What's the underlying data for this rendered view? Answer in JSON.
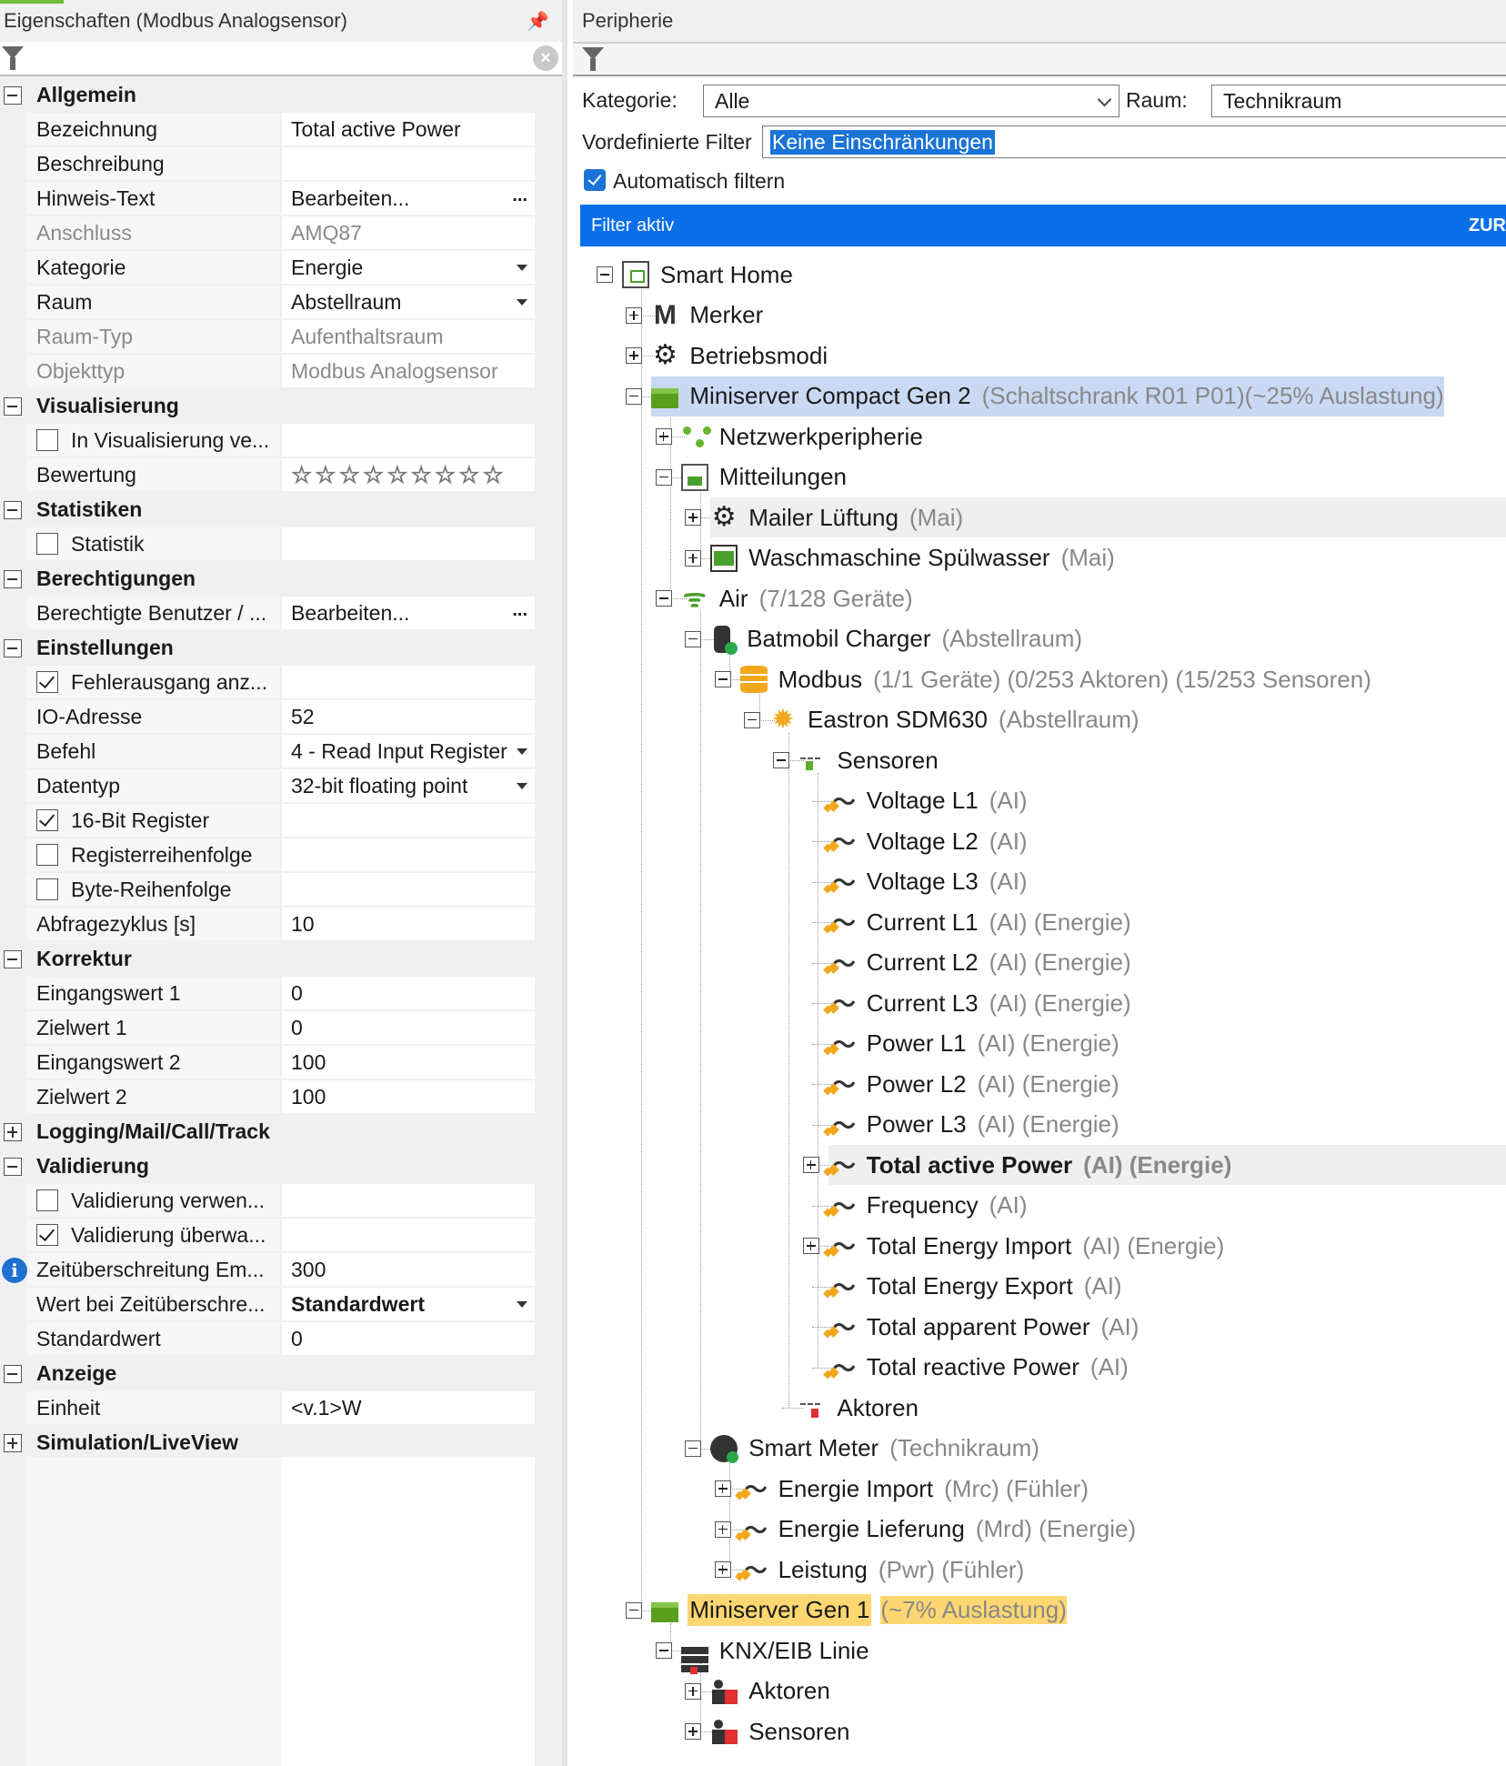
{
  "left_panel": {
    "title": "Eigenschaften (Modbus Analogsensor)",
    "pin_icon": "pin-icon",
    "filter_icon": "funnel-icon",
    "clear_icon": "clear-icon",
    "rows": [
      {
        "type": "cat",
        "expanded": true,
        "name": "Allgemein"
      },
      {
        "type": "prop",
        "name": "Bezeichnung",
        "value": "Total active Power"
      },
      {
        "type": "prop",
        "name": "Beschreibung",
        "value": ""
      },
      {
        "type": "prop",
        "name": "Hinweis-Text",
        "value": "Bearbeiten...",
        "editor": "dots"
      },
      {
        "type": "prop",
        "name": "Anschluss",
        "value": "AMQ87",
        "disabled": true
      },
      {
        "type": "prop",
        "name": "Kategorie",
        "value": "Energie",
        "editor": "dropdown"
      },
      {
        "type": "prop",
        "name": "Raum",
        "value": "Abstellraum",
        "editor": "dropdown"
      },
      {
        "type": "prop",
        "name": "Raum-Typ",
        "value": "Aufenthaltsraum",
        "disabled": true
      },
      {
        "type": "prop",
        "name": "Objekttyp",
        "value": "Modbus Analogsensor",
        "disabled": true
      },
      {
        "type": "cat",
        "expanded": true,
        "name": "Visualisierung"
      },
      {
        "type": "check",
        "name": "In Visualisierung ve...",
        "checked": false
      },
      {
        "type": "prop",
        "name": "Bewertung",
        "value": "☆☆☆☆☆☆☆☆☆",
        "editor": "stars"
      },
      {
        "type": "cat",
        "expanded": true,
        "name": "Statistiken"
      },
      {
        "type": "check",
        "name": "Statistik",
        "checked": false
      },
      {
        "type": "cat",
        "expanded": true,
        "name": "Berechtigungen"
      },
      {
        "type": "prop",
        "name": "Berechtigte Benutzer / ...",
        "value": "Bearbeiten...",
        "editor": "dots"
      },
      {
        "type": "cat",
        "expanded": true,
        "name": "Einstellungen"
      },
      {
        "type": "check",
        "name": "Fehlerausgang anz...",
        "checked": true
      },
      {
        "type": "prop",
        "name": "IO-Adresse",
        "value": "52"
      },
      {
        "type": "prop",
        "name": "Befehl",
        "value": "4 - Read Input Register",
        "editor": "dropdown"
      },
      {
        "type": "prop",
        "name": "Datentyp",
        "value": "32-bit floating point",
        "editor": "dropdown"
      },
      {
        "type": "check",
        "name": "16-Bit Register",
        "checked": true
      },
      {
        "type": "check",
        "name": "Registerreihenfolge",
        "checked": false
      },
      {
        "type": "check",
        "name": "Byte-Reihenfolge",
        "checked": false
      },
      {
        "type": "prop",
        "name": "Abfragezyklus [s]",
        "value": "10"
      },
      {
        "type": "cat",
        "expanded": true,
        "name": "Korrektur"
      },
      {
        "type": "prop",
        "name": "Eingangswert 1",
        "value": "0"
      },
      {
        "type": "prop",
        "name": "Zielwert 1",
        "value": "0"
      },
      {
        "type": "prop",
        "name": "Eingangswert 2",
        "value": "100"
      },
      {
        "type": "prop",
        "name": "Zielwert 2",
        "value": "100"
      },
      {
        "type": "cat",
        "expanded": false,
        "name": "Logging/Mail/Call/Track"
      },
      {
        "type": "cat",
        "expanded": true,
        "name": "Validierung"
      },
      {
        "type": "check",
        "name": "Validierung verwen...",
        "checked": false
      },
      {
        "type": "check",
        "name": "Validierung überwa...",
        "checked": true
      },
      {
        "type": "prop",
        "name": "Zeitüberschreitung Em...",
        "value": "300",
        "info": true
      },
      {
        "type": "prop",
        "name": "Wert bei Zeitüberschre...",
        "value": "Standardwert",
        "editor": "dropdown",
        "bold": true
      },
      {
        "type": "prop",
        "name": "Standardwert",
        "value": "0"
      },
      {
        "type": "cat",
        "expanded": true,
        "name": "Anzeige"
      },
      {
        "type": "prop",
        "name": "Einheit",
        "value": "<v.1>W"
      },
      {
        "type": "cat",
        "expanded": false,
        "name": "Simulation/LiveView"
      }
    ]
  },
  "right_panel": {
    "title": "Peripherie",
    "kategorie_label": "Kategorie:",
    "kategorie_value": "Alle",
    "raum_label": "Raum:",
    "raum_value": "Technikraum",
    "vordefiniert_label": "Vordefinierte Filter",
    "vordefiniert_value": "Keine Einschränkungen",
    "auto_filter_label": "Automatisch filtern",
    "auto_filter_checked": true,
    "filter_active_label": "Filter aktiv",
    "filter_reset_label": "ZUR",
    "accent_color": "#0a6fe8",
    "tree": [
      {
        "depth": 0,
        "exp": "minus",
        "icon": "smart-home-icon",
        "cls": "i-home",
        "label": "Smart Home",
        "sub": ""
      },
      {
        "depth": 1,
        "exp": "plus",
        "icon": "merker-icon",
        "cls": "i-M",
        "glyph": "M",
        "label": "Merker",
        "sub": ""
      },
      {
        "depth": 1,
        "exp": "plus",
        "icon": "gear-icon",
        "cls": "i-gear",
        "glyph": "⚙",
        "label": "Betriebsmodi",
        "sub": ""
      },
      {
        "depth": 1,
        "exp": "minus",
        "icon": "miniserver-icon",
        "cls": "i-server",
        "label": "Miniserver Compact Gen 2",
        "sub": "(Schaltschrank R01 P01)(~25% Auslastung)",
        "hl": "blue"
      },
      {
        "depth": 2,
        "exp": "plus",
        "icon": "network-icon",
        "cls": "i-net",
        "label": "Netzwerkperipherie",
        "sub": ""
      },
      {
        "depth": 2,
        "exp": "minus",
        "icon": "messages-icon",
        "cls": "i-msg",
        "label": "Mitteilungen",
        "sub": ""
      },
      {
        "depth": 3,
        "exp": "plus",
        "icon": "gear-icon",
        "cls": "i-gear",
        "glyph": "⚙",
        "label": "Mailer Lüftung",
        "sub": "(Mai)",
        "hl": "gray"
      },
      {
        "depth": 3,
        "exp": "plus",
        "icon": "mail-icon",
        "cls": "i-mail",
        "label": "Waschmaschine Spülwasser",
        "sub": "(Mai)"
      },
      {
        "depth": 2,
        "exp": "minus",
        "icon": "wifi-icon",
        "cls": "i-wifi",
        "glyph": "ᯤ",
        "label": "Air",
        "sub": "(7/128 Geräte)"
      },
      {
        "depth": 3,
        "exp": "minus",
        "icon": "charger-icon",
        "cls": "i-charger",
        "label": "Batmobil Charger",
        "sub": "(Abstellraum)"
      },
      {
        "depth": 4,
        "exp": "minus",
        "icon": "database-icon",
        "cls": "i-db",
        "label": "Modbus",
        "sub": "(1/1 Geräte) (0/253 Aktoren) (15/253 Sensoren)"
      },
      {
        "depth": 5,
        "exp": "minus",
        "icon": "sun-icon",
        "cls": "i-sun",
        "glyph": "✹",
        "label": "Eastron SDM630",
        "sub": "(Abstellraum)"
      },
      {
        "depth": 6,
        "exp": "minus",
        "icon": "sensors-icon",
        "cls": "i-sensors",
        "label": "Sensoren",
        "sub": ""
      },
      {
        "depth": 7,
        "exp": "",
        "icon": "analog-input-icon",
        "cls": "i-ai",
        "label": "Voltage L1",
        "sub": "(AI)"
      },
      {
        "depth": 7,
        "exp": "",
        "icon": "analog-input-icon",
        "cls": "i-ai",
        "label": "Voltage L2",
        "sub": "(AI)"
      },
      {
        "depth": 7,
        "exp": "",
        "icon": "analog-input-icon",
        "cls": "i-ai",
        "label": "Voltage L3",
        "sub": "(AI)"
      },
      {
        "depth": 7,
        "exp": "",
        "icon": "analog-input-icon",
        "cls": "i-ai",
        "label": "Current L1",
        "sub": "(AI) (Energie)"
      },
      {
        "depth": 7,
        "exp": "",
        "icon": "analog-input-icon",
        "cls": "i-ai",
        "label": "Current L2",
        "sub": "(AI) (Energie)"
      },
      {
        "depth": 7,
        "exp": "",
        "icon": "analog-input-icon",
        "cls": "i-ai",
        "label": "Current L3",
        "sub": "(AI) (Energie)"
      },
      {
        "depth": 7,
        "exp": "",
        "icon": "analog-input-icon",
        "cls": "i-ai",
        "label": "Power L1",
        "sub": "(AI) (Energie)"
      },
      {
        "depth": 7,
        "exp": "",
        "icon": "analog-input-icon",
        "cls": "i-ai",
        "label": "Power L2",
        "sub": "(AI) (Energie)"
      },
      {
        "depth": 7,
        "exp": "",
        "icon": "analog-input-icon",
        "cls": "i-ai",
        "label": "Power L3",
        "sub": "(AI) (Energie)"
      },
      {
        "depth": 7,
        "exp": "plus",
        "icon": "analog-input-icon",
        "cls": "i-ai",
        "label": "Total active Power",
        "sub": "(AI) (Energie)",
        "hl": "gray",
        "bold": true
      },
      {
        "depth": 7,
        "exp": "",
        "icon": "analog-input-icon",
        "cls": "i-ai",
        "label": "Frequency",
        "sub": "(AI)"
      },
      {
        "depth": 7,
        "exp": "plus",
        "icon": "analog-input-icon",
        "cls": "i-ai",
        "label": "Total Energy Import",
        "sub": "(AI) (Energie)"
      },
      {
        "depth": 7,
        "exp": "",
        "icon": "analog-input-icon",
        "cls": "i-ai",
        "label": "Total Energy Export",
        "sub": "(AI)"
      },
      {
        "depth": 7,
        "exp": "",
        "icon": "analog-input-icon",
        "cls": "i-ai",
        "label": "Total apparent Power",
        "sub": "(AI)"
      },
      {
        "depth": 7,
        "exp": "",
        "icon": "analog-input-icon",
        "cls": "i-ai",
        "label": "Total reactive Power",
        "sub": "(AI)"
      },
      {
        "depth": 6,
        "exp": "",
        "icon": "actuators-icon",
        "cls": "i-act",
        "label": "Aktoren",
        "sub": ""
      },
      {
        "depth": 3,
        "exp": "minus",
        "icon": "smart-meter-icon",
        "cls": "i-meter",
        "label": "Smart Meter",
        "sub": "(Technikraum)"
      },
      {
        "depth": 4,
        "exp": "plus",
        "icon": "analog-input-icon",
        "cls": "i-ai",
        "label": "Energie Import",
        "sub": "(Mrc) (Fühler)"
      },
      {
        "depth": 4,
        "exp": "plus",
        "icon": "analog-input-icon",
        "cls": "i-ai",
        "label": "Energie Lieferung",
        "sub": "(Mrd) (Energie)"
      },
      {
        "depth": 4,
        "exp": "plus",
        "icon": "analog-input-icon",
        "cls": "i-ai",
        "label": "Leistung",
        "sub": "(Pwr) (Fühler)"
      },
      {
        "depth": 1,
        "exp": "minus",
        "icon": "miniserver-icon",
        "cls": "i-server",
        "label": "Miniserver Gen 1",
        "sub": "(~7% Auslastung)",
        "hl": "yellow"
      },
      {
        "depth": 2,
        "exp": "minus",
        "icon": "knx-icon",
        "cls": "i-knx",
        "label": "KNX/EIB Linie",
        "sub": ""
      },
      {
        "depth": 3,
        "exp": "plus",
        "icon": "knx-actuators-icon",
        "cls": "i-person",
        "label": "Aktoren",
        "sub": ""
      },
      {
        "depth": 3,
        "exp": "plus",
        "icon": "knx-sensors-icon",
        "cls": "i-person",
        "label": "Sensoren",
        "sub": ""
      }
    ]
  }
}
